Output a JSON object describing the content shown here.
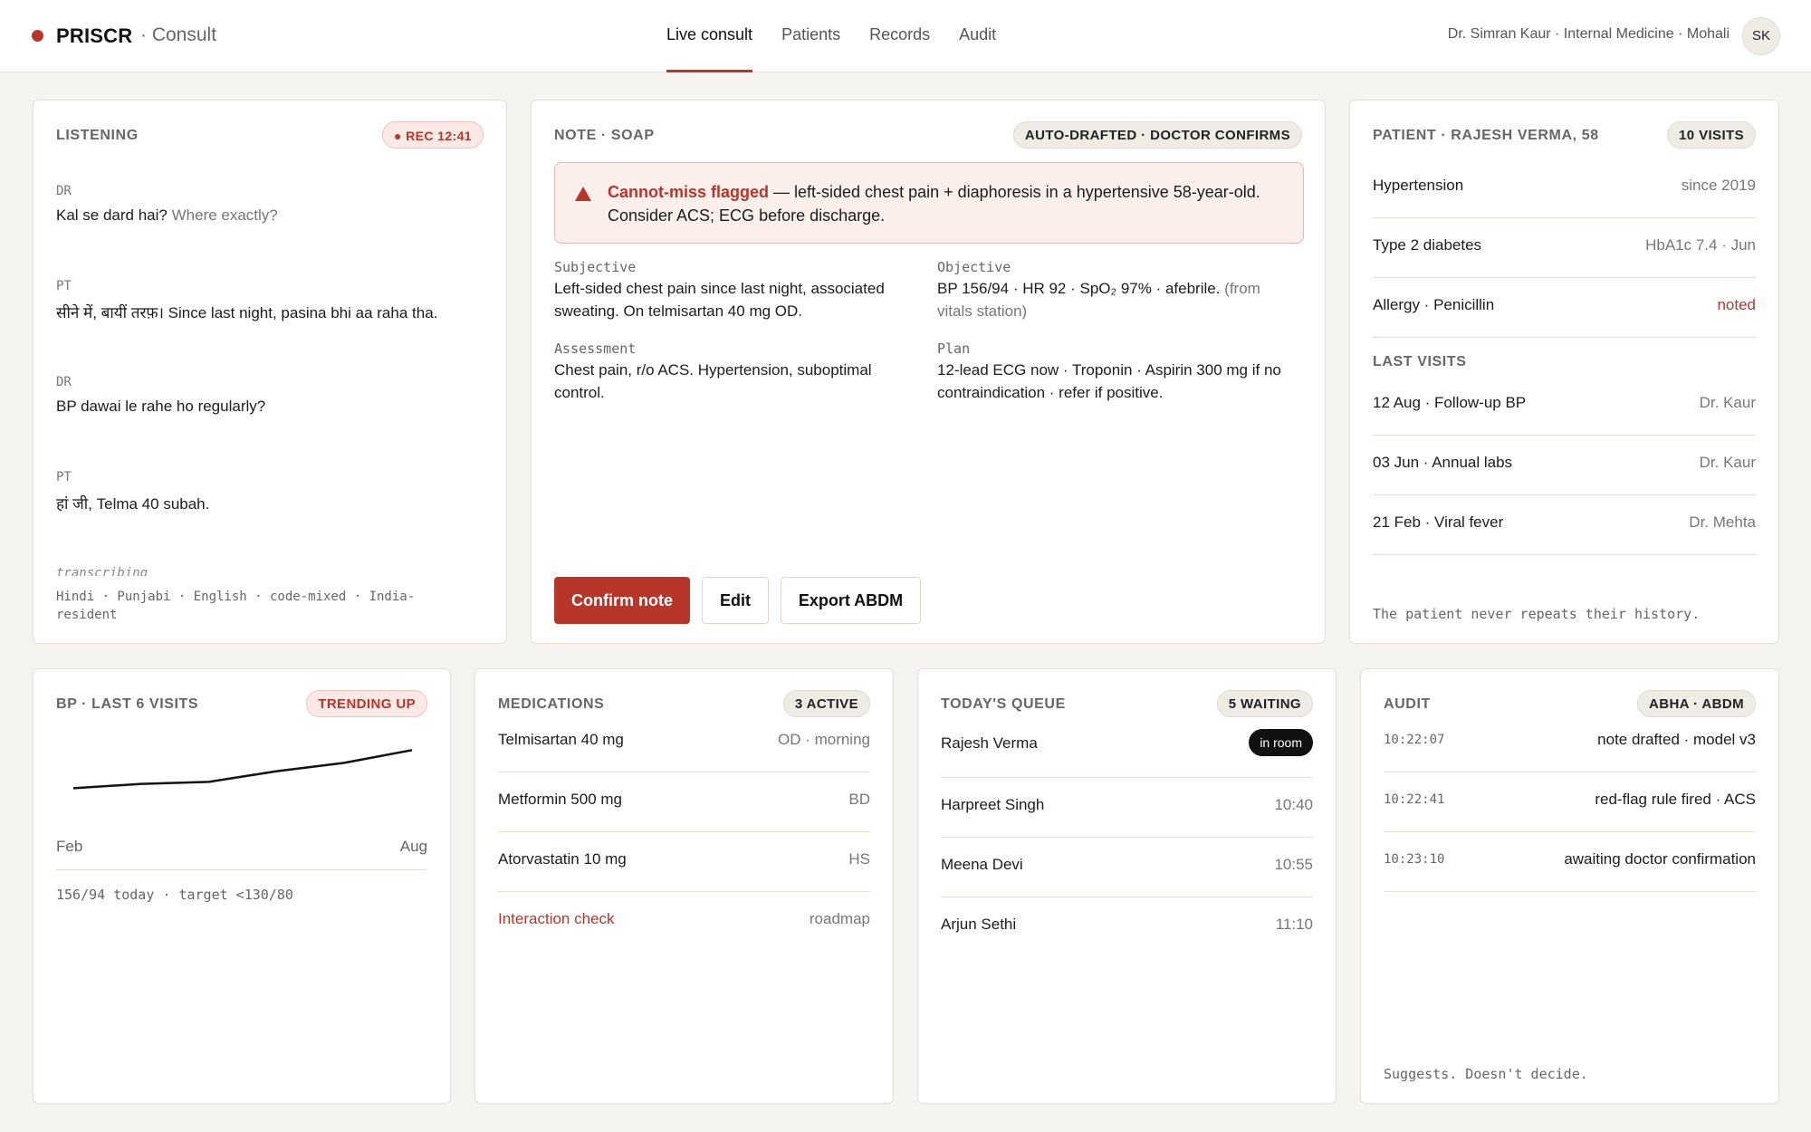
{
  "topbar": {
    "brand": "PRISCR",
    "brand_suffix": "· Consult",
    "nav": [
      "Live consult",
      "Patients",
      "Records",
      "Audit"
    ],
    "doctor": "Dr. Simran Kaur · Internal Medicine · Mohali",
    "avatar_initials": "SK"
  },
  "listening": {
    "title": "LISTENING",
    "rec_badge": "● REC 12:41",
    "turns": [
      {
        "speaker": "DR",
        "text": "Kal se dard hai?",
        "aside": " Where exactly?"
      },
      {
        "speaker": "PT",
        "text": "सीने में, बायीं तरफ़। Since last night, pasina bhi aa raha tha.",
        "aside": ""
      },
      {
        "speaker": "DR",
        "text": "BP dawai le rahe ho regularly?",
        "aside": ""
      },
      {
        "speaker": "PT",
        "text": "हां जी, Telma 40 subah.",
        "aside": ""
      }
    ],
    "transcribing": "transcribing",
    "languages": "Hindi · Punjabi · English · code-mixed · India-resident"
  },
  "note": {
    "title": "NOTE · SOAP",
    "badge": "AUTO-DRAFTED · DOCTOR CONFIRMS",
    "alert_strong": "Cannot-miss flagged",
    "alert_text": " — left-sided chest pain + diaphoresis in a hypertensive 58-year-old. Consider ACS; ECG before discharge.",
    "subjective_label": "Subjective",
    "subjective": "Left-sided chest pain since last night, associated sweating. On telmisartan 40 mg OD.",
    "objective_label": "Objective",
    "objective_main": "BP 156/94 · HR 92 · SpO₂ 97% · afebrile.",
    "objective_aside": " (from vitals station)",
    "assessment_label": "Assessment",
    "assessment": "Chest pain, r/o ACS. Hypertension, suboptimal control.",
    "plan_label": "Plan",
    "plan": "12-lead ECG now · Troponin · Aspirin 300 mg if no contraindication · refer if positive.",
    "confirm_label": "Confirm note",
    "edit_label": "Edit",
    "export_label": "Export ABDM"
  },
  "patient": {
    "title": "PATIENT · RAJESH VERMA, 58",
    "badge": "10 VISITS",
    "conditions": [
      {
        "label": "Hypertension",
        "value": "since 2019",
        "alert": false
      },
      {
        "label": "Type 2 diabetes",
        "value": "HbA1c 7.4 · Jun",
        "alert": false
      },
      {
        "label": "Allergy · Penicillin",
        "value": "noted",
        "alert": true
      }
    ],
    "last_visits_title": "LAST VISITS",
    "visits": [
      {
        "label": "12 Aug · Follow-up BP",
        "value": "Dr. Kaur"
      },
      {
        "label": "03 Jun · Annual labs",
        "value": "Dr. Kaur"
      },
      {
        "label": "21 Feb · Viral fever",
        "value": "Dr. Mehta"
      }
    ],
    "footer": "The patient never repeats their history."
  },
  "bp": {
    "title": "BP · LAST 6 VISITS",
    "badge": "TRENDING UP",
    "x_start": "Feb",
    "x_end": "Aug",
    "footer": "156/94 today · target <130/80"
  },
  "chart_data": {
    "type": "line",
    "title": "BP · LAST 6 VISITS",
    "x_tick_labels": [
      "Feb",
      "Aug"
    ],
    "series": [
      {
        "values": [
          138,
          140,
          141,
          146,
          150,
          156
        ]
      }
    ],
    "ylim": [
      130,
      160
    ],
    "grid": false
  },
  "medications": {
    "title": "MEDICATIONS",
    "badge": "3 ACTIVE",
    "items": [
      {
        "label": "Telmisartan 40 mg",
        "value": "OD · morning",
        "alert": false
      },
      {
        "label": "Metformin 500 mg",
        "value": "BD",
        "alert": false
      },
      {
        "label": "Atorvastatin 10 mg",
        "value": "HS",
        "alert": false
      },
      {
        "label": "Interaction check",
        "value": "roadmap",
        "alert": true
      }
    ]
  },
  "queue": {
    "title": "TODAY'S QUEUE",
    "badge": "5 WAITING",
    "items": [
      {
        "name": "Rajesh Verma",
        "status": "in room"
      },
      {
        "name": "Harpreet Singh",
        "status": "10:40"
      },
      {
        "name": "Meena Devi",
        "status": "10:55"
      },
      {
        "name": "Arjun Sethi",
        "status": "11:10"
      }
    ]
  },
  "audit": {
    "title": "AUDIT",
    "badge": "ABHA · ABDM",
    "entries": [
      {
        "time": "10:22:07",
        "event": "note drafted · model v3"
      },
      {
        "time": "10:22:41",
        "event": "red-flag rule fired · ACS"
      },
      {
        "time": "10:23:10",
        "event": "awaiting doctor confirmation"
      }
    ],
    "footer": "Suggests. Doesn't decide."
  },
  "colors": {
    "accent": "#b8352a",
    "background": "#f5f4f0",
    "card": "#ffffff",
    "line": "#111111"
  }
}
